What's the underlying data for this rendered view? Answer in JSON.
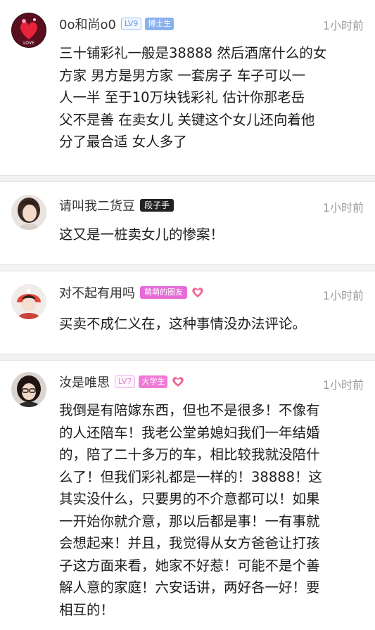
{
  "comments": [
    {
      "username": "0o和尚o0",
      "level": "LV9",
      "title": "博士生",
      "time": "1小时前",
      "lines": [
        "三十铺彩礼一般是38888 然后酒席什么的女",
        "方家  男方是男方家  一套房子 车子可以一",
        "人一半  至于10万块钱彩礼  估计你那老岳",
        "父不是善 在卖女儿  关键这个女儿还向着他",
        "分了最合适  女人多了"
      ],
      "avatar_label": "LOVE"
    },
    {
      "username": "请叫我二货豆",
      "title": "段子手",
      "time": "1小时前",
      "lines": [
        "这又是一桩卖女儿的惨案！"
      ]
    },
    {
      "username": "对不起有用吗",
      "title": "萌萌的圈友",
      "time": "1小时前",
      "lines": [
        "买卖不成仁义在，这种事情没办法评论。"
      ]
    },
    {
      "username": "汝是唯思",
      "level": "LV7",
      "title": "大学生",
      "time": "1小时前",
      "lines": [
        "我倒是有陪嫁东西，但也不是很多！不像有",
        "的人还陪车！我老公堂弟媳妇我们一年结婚",
        "的，陪了二十多万的车，相比较我就没陪什",
        "么了！但我们彩礼都是一样的！38888！这",
        "其实没什么，只要男的不介意都可以！如果",
        "一开始你就介意，那以后都是事！一有事就",
        "会想起来！并且，我觉得从女方爸爸让打孩",
        "子这方面来看，她家不好惹！可能不是个善",
        "解人意的家庭！六安话讲，两好各一好！要",
        "相互的！"
      ]
    }
  ],
  "colors": {
    "badge_blue": "#8ab1ee",
    "badge_pink": "#e66bd6",
    "time_gray": "#9a9a9a",
    "separator": "#f2f2f2"
  }
}
